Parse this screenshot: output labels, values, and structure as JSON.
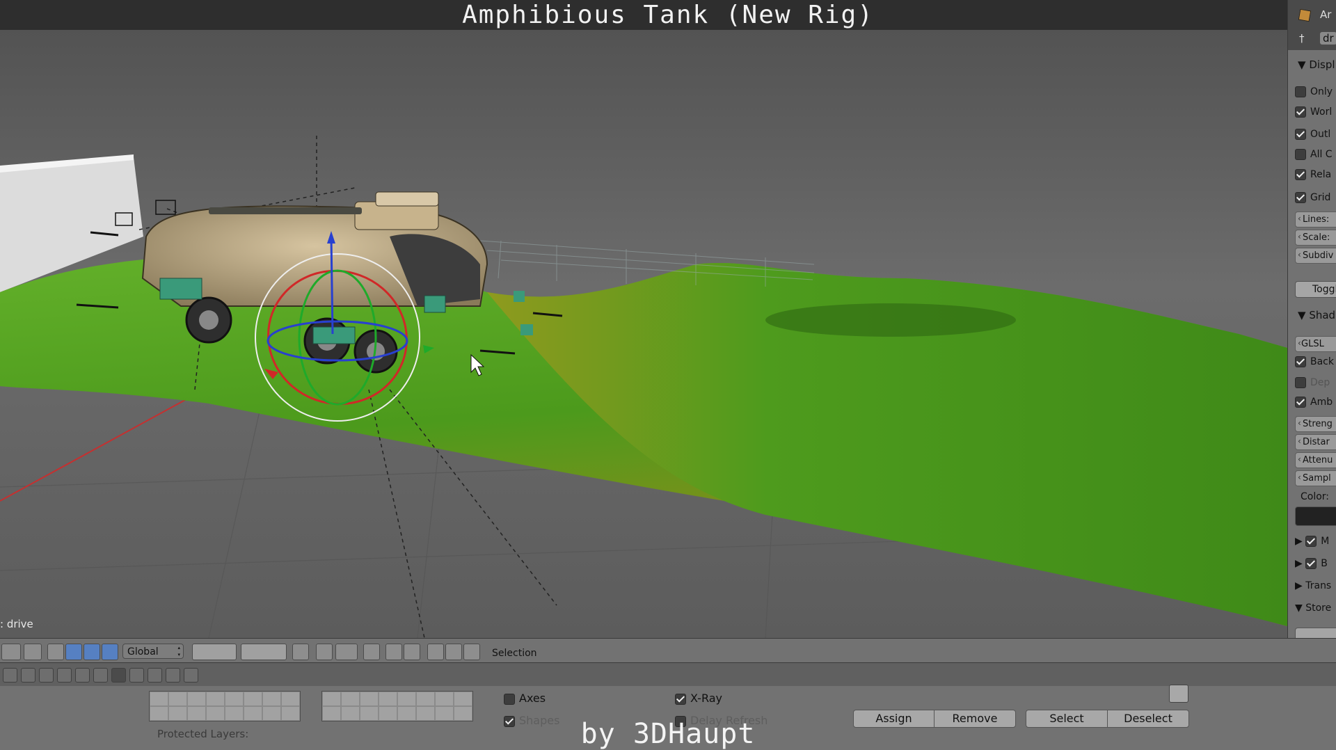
{
  "overlay": {
    "title": "Amphibious Tank (New Rig)",
    "byline": "by 3DHaupt"
  },
  "viewport": {
    "mode_label": ": drive"
  },
  "properties_panel": {
    "header_items": [
      "Ar",
      "dr"
    ],
    "display": {
      "section_label": "Displ",
      "rows": [
        {
          "label": "Only",
          "checked": false
        },
        {
          "label": "Worl",
          "checked": true
        },
        {
          "label": "Outl",
          "checked": true
        },
        {
          "label": "All C",
          "checked": false
        },
        {
          "label": "Rela",
          "checked": true
        },
        {
          "label": "Grid",
          "checked": true
        }
      ],
      "fields": [
        "Lines:",
        "Scale:",
        "Subdiv"
      ],
      "toggle_label": "Toggle"
    },
    "shading": {
      "section_label": "Shad",
      "mode": "GLSL",
      "rows": [
        {
          "label": "Back",
          "checked": true
        },
        {
          "label": "Dep",
          "checked": false
        },
        {
          "label": "Amb",
          "checked": true
        }
      ],
      "fields": [
        "Streng",
        "Distar",
        "Attenu",
        "Sampl"
      ],
      "color_label": "Color:"
    },
    "collapsed_sections": [
      {
        "label": "M",
        "checked": true
      },
      {
        "label": "B",
        "checked": true
      },
      {
        "label": "Trans"
      },
      {
        "label": "Store"
      }
    ]
  },
  "toolbar": {
    "orientation": "Global",
    "selection_label": "Selection"
  },
  "bottom_panel": {
    "axes": {
      "label": "Axes",
      "checked": false
    },
    "shapes": {
      "label": "Shapes",
      "checked": true
    },
    "xray": {
      "label": "X-Ray",
      "checked": true
    },
    "delay_refresh": {
      "label": "Delay Refresh",
      "checked": false
    },
    "buttons": {
      "assign": "Assign",
      "remove": "Remove",
      "select": "Select",
      "deselect": "Deselect"
    },
    "protected_layers_label": "Protected Layers:"
  },
  "colors": {
    "terrain_green": "#4c9a1c",
    "terrain_yellow": "#9a8a1a",
    "selected_blue": "#5680c2",
    "panel_gray": "#727272"
  }
}
